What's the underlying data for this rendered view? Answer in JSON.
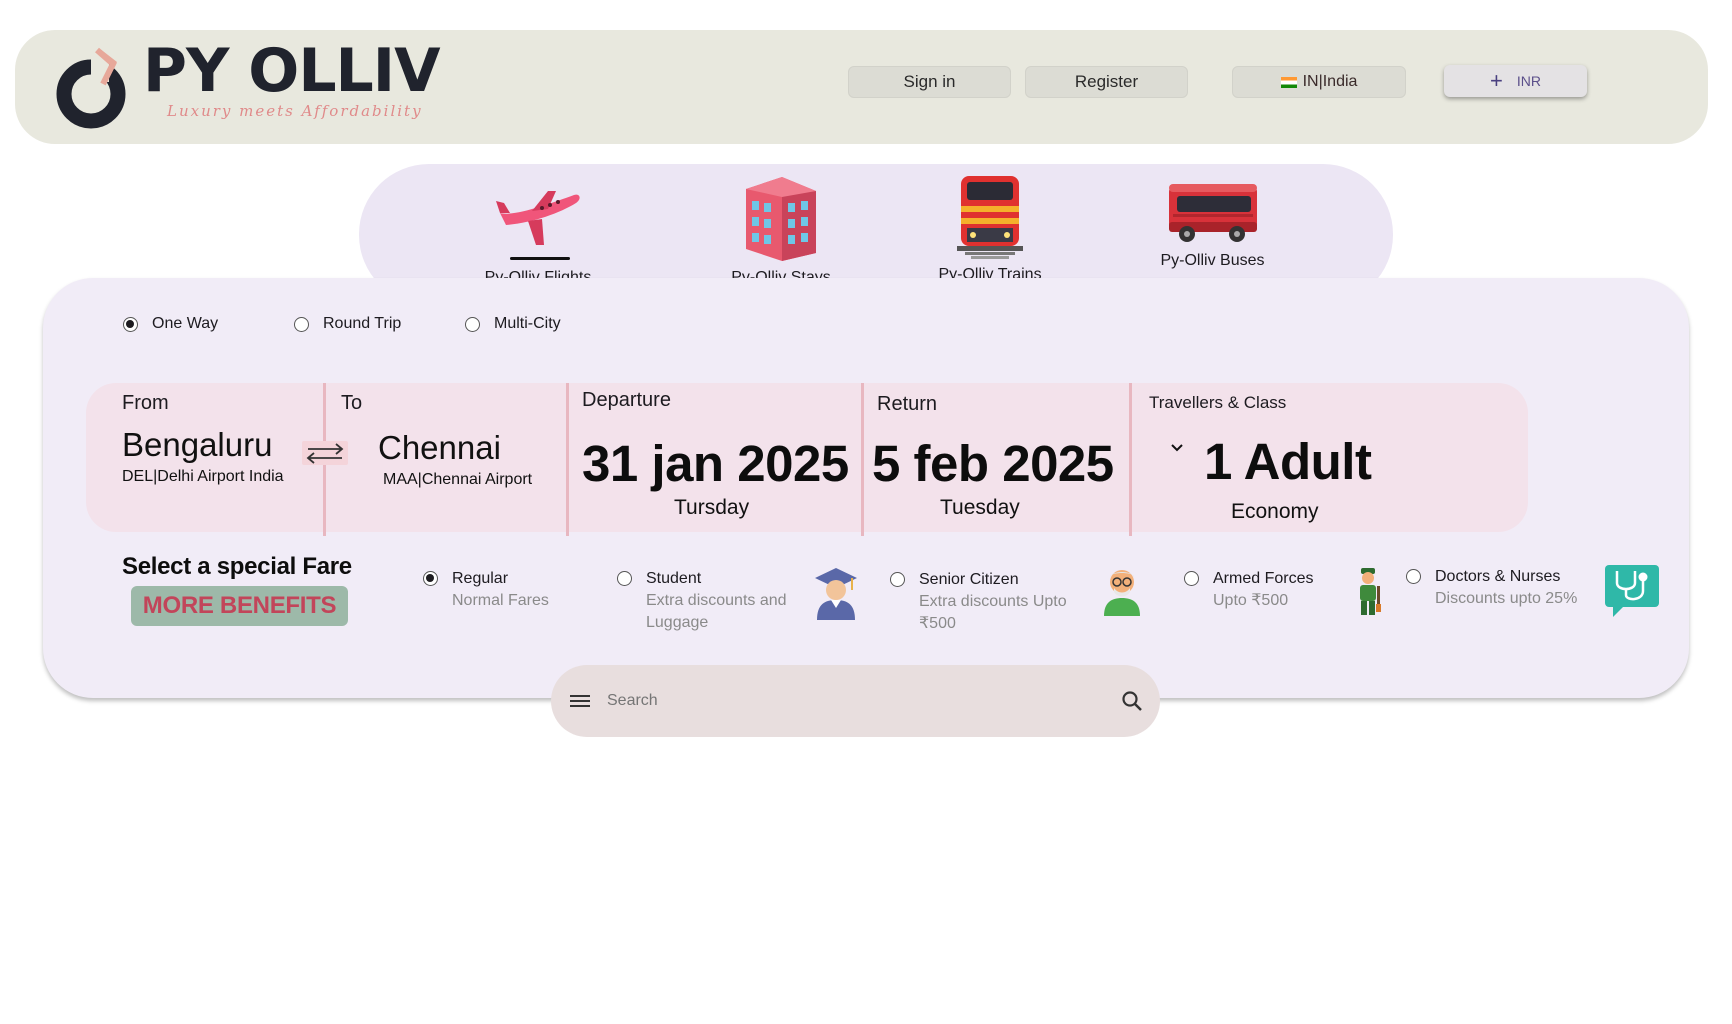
{
  "header": {
    "logo_text": "PY OLLIV",
    "tagline": "Luxury meets Affordability",
    "sign_in": "Sign in",
    "register": "Register",
    "country": "IN|India",
    "currency": "INR"
  },
  "services": [
    {
      "label": "Py-Olliv Flights",
      "icon": "airplane-icon"
    },
    {
      "label": "Py-Olliv Stays",
      "icon": "hotel-icon"
    },
    {
      "label": "Py-Olliv Trains",
      "icon": "train-icon"
    },
    {
      "label": "Py-Olliv Buses",
      "icon": "bus-icon"
    }
  ],
  "trip_types": [
    {
      "label": "One Way",
      "selected": true
    },
    {
      "label": "Round Trip",
      "selected": false
    },
    {
      "label": "Multi-City",
      "selected": false
    }
  ],
  "search": {
    "from_label": "From",
    "from_city": "Bengaluru",
    "from_airport": "DEL|Delhi Airport India",
    "to_label": "To",
    "to_city": "Chennai",
    "to_airport": "MAA|Chennai Airport",
    "departure_label": "Departure",
    "departure_date": "31 jan 2025",
    "departure_day": "Tursday",
    "return_label": "Return",
    "return_date": "5 feb 2025",
    "return_day": "Tuesday",
    "travellers_label": "Travellers & Class",
    "travellers": "1 Adult",
    "class": "Economy"
  },
  "fares": {
    "title": "Select a special Fare",
    "more_benefits": "MORE BENEFITS",
    "options": [
      {
        "name": "Regular",
        "desc": "Normal Fares",
        "selected": true
      },
      {
        "name": "Student",
        "desc": "Extra discounts and Luggage",
        "selected": false,
        "icon": "graduate-icon"
      },
      {
        "name": "Senior Citizen",
        "desc": "Extra discounts Upto ₹500",
        "selected": false,
        "icon": "senior-icon"
      },
      {
        "name": "Armed Forces",
        "desc": "Upto ₹500",
        "selected": false,
        "icon": "soldier-icon"
      },
      {
        "name": "Doctors & Nurses",
        "desc": "Discounts upto 25%",
        "selected": false,
        "icon": "stethoscope-icon"
      }
    ]
  },
  "searchbar": {
    "placeholder": "Search"
  }
}
